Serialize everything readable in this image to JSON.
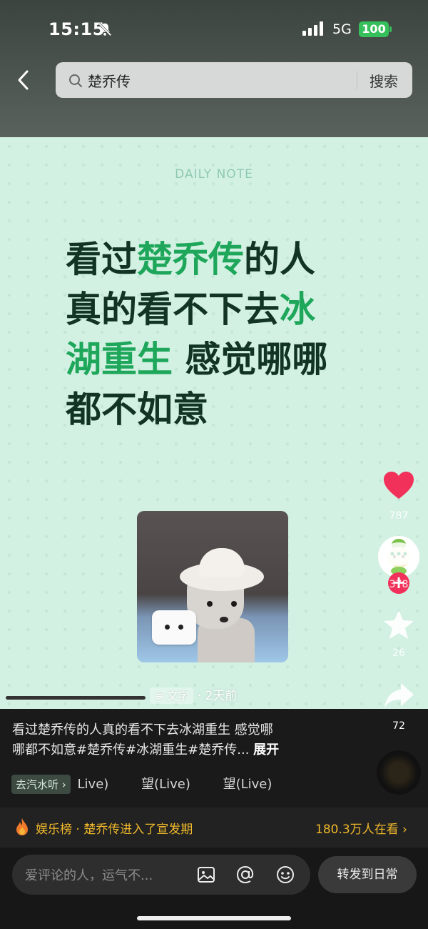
{
  "status_bar": {
    "time": "15:15",
    "network": "5G",
    "battery": "100"
  },
  "search": {
    "query": "楚乔传",
    "button_label": "搜索"
  },
  "post": {
    "daily_note": "DAILY NOTE",
    "headline_lines": [
      [
        {
          "t": "看过",
          "hl": false
        },
        {
          "t": "楚乔传",
          "hl": true
        },
        {
          "t": "的人",
          "hl": false
        }
      ],
      [
        {
          "t": "真的看不下去",
          "hl": false
        },
        {
          "t": "冰",
          "hl": true
        }
      ],
      [
        {
          "t": "湖重生",
          "hl": true
        },
        {
          "t": " 感觉哪哪",
          "hl": false
        }
      ],
      [
        {
          "t": "都不如意",
          "hl": false
        }
      ]
    ],
    "text_tag": "文字",
    "time_ago": "· 2天前"
  },
  "actions": {
    "likes": "787",
    "comments": "378",
    "favorites": "26",
    "shares": "72"
  },
  "caption": {
    "line1": "看过楚乔传的人真的看不下去冰湖重生 感觉哪",
    "line2": "哪都不如意#楚乔传#冰湖重生#楚乔传... ",
    "expand": "展开"
  },
  "listen": {
    "button": "去汽水听",
    "songs": [
      "Live)",
      "望(Live)",
      "望(Live)"
    ]
  },
  "hot": {
    "text": "娱乐榜 · 楚乔传进入了宣发期",
    "watching": "180.3万人在看"
  },
  "bottom": {
    "comment_placeholder": "爱评论的人，运气不...",
    "repost": "转发到日常"
  },
  "colors": {
    "accent_green": "#1ea75a",
    "like_red": "#f2315a",
    "hot_gold": "#f0b92b"
  }
}
